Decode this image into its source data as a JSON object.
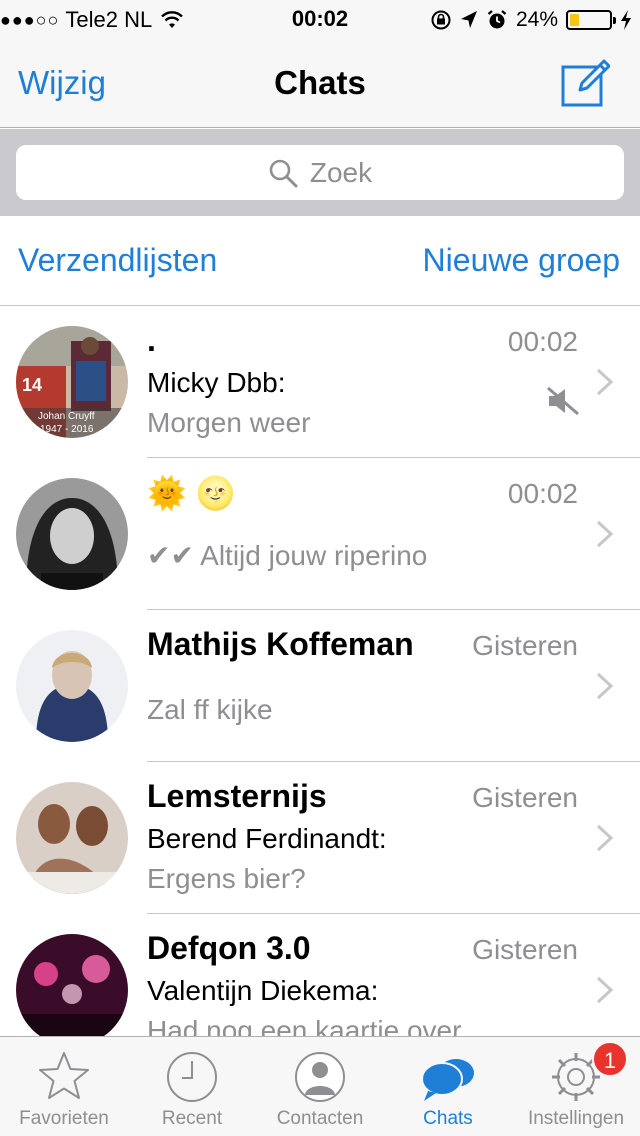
{
  "status_bar": {
    "signal": "●●●○○",
    "carrier": "Tele2 NL",
    "time": "00:02",
    "battery": "24%",
    "battery_level": 0.24,
    "icons": [
      "wifi-icon",
      "rotation-lock-icon",
      "location-icon",
      "alarm-icon",
      "charging-icon"
    ]
  },
  "nav": {
    "edit_label": "Wijzig",
    "title": "Chats",
    "compose_icon": "compose-icon"
  },
  "search": {
    "placeholder": "Zoek"
  },
  "lists": {
    "broadcast_label": "Verzendlijsten",
    "new_group_label": "Nieuwe groep"
  },
  "chats": [
    {
      "name": ".",
      "time": "00:02",
      "sender": "Micky Dbb:",
      "message": "Morgen weer",
      "muted": true
    },
    {
      "name": "🌞 🌝",
      "time": "00:02",
      "sender": "",
      "message": "✔✔ Altijd jouw riperino",
      "muted": false
    },
    {
      "name": "Mathijs Koffeman",
      "time": "Gisteren",
      "sender": "",
      "message": "Zal ff kijke",
      "muted": false
    },
    {
      "name": "Lemsternijs",
      "time": "Gisteren",
      "sender": "Berend Ferdinandt:",
      "message": "Ergens bier?",
      "muted": false
    },
    {
      "name": "Defqon 3.0",
      "time": "Gisteren",
      "sender": "Valentijn Diekema:",
      "message": "Had nog een kaartje over",
      "muted": false
    }
  ],
  "avatar_texts": {
    "cruyff_number": "14",
    "cruyff_caption": "Johan Cruyff",
    "cruyff_years": "1947 - 2016"
  },
  "tabs": [
    {
      "label": "Favorieten",
      "icon": "star-icon"
    },
    {
      "label": "Recent",
      "icon": "clock-icon"
    },
    {
      "label": "Contacten",
      "icon": "contact-icon"
    },
    {
      "label": "Chats",
      "icon": "chat-bubbles-icon",
      "active": true
    },
    {
      "label": "Instellingen",
      "icon": "gear-icon",
      "badge": "1"
    }
  ],
  "colors": {
    "accent": "#1f7fd6",
    "badge": "#e8342c",
    "secondary_text": "#8e8e93",
    "bar_background": "#f7f7f7"
  }
}
